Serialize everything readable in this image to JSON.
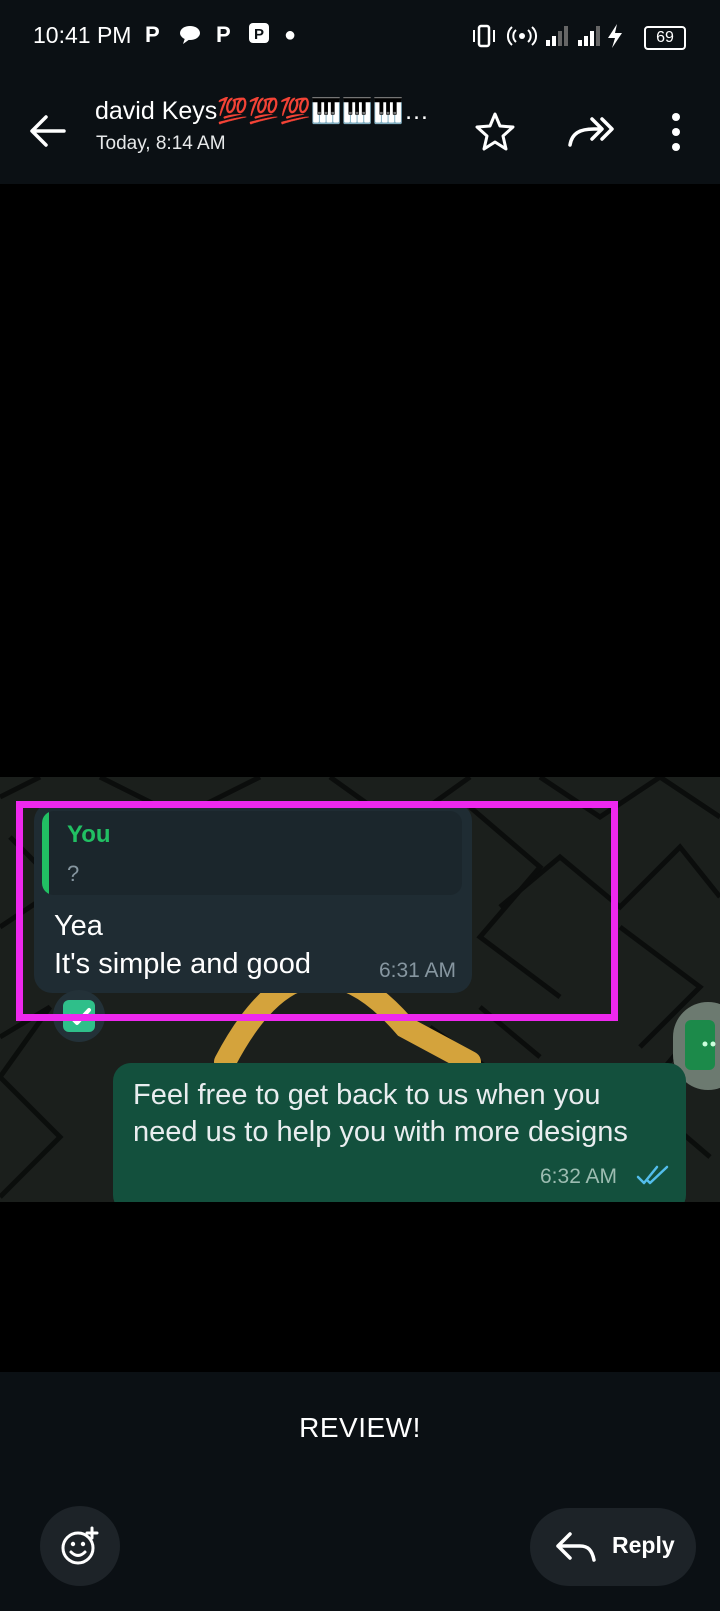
{
  "status_bar": {
    "time": "10:41 PM",
    "notification_icons": [
      "P",
      "●",
      "P",
      "P"
    ],
    "battery": "69"
  },
  "header": {
    "contact_name": "david Keys💯💯💯🎹🎹🎹…",
    "subtitle": "Today, 8:14 AM",
    "icons": [
      "back-arrow-icon",
      "star-icon",
      "forward-icon",
      "more-vertical-icon"
    ]
  },
  "image": {
    "incoming": {
      "quote_author": "You",
      "quote_text": "?",
      "line1": "Yea",
      "line2": "It's simple and good",
      "time": "6:31 AM"
    },
    "outgoing": {
      "text": "Feel free to get back to us when you need us to help you with more designs",
      "time": "6:32 AM"
    },
    "highlight_color": "#ee28ee"
  },
  "footer": {
    "caption": "REVIEW!",
    "reply_label": "Reply"
  },
  "colors": {
    "accent_green": "#21c063",
    "outgoing_bubble": "#13503d",
    "incoming_bubble": "#1f2c33",
    "read_ticks": "#53bdeb"
  }
}
